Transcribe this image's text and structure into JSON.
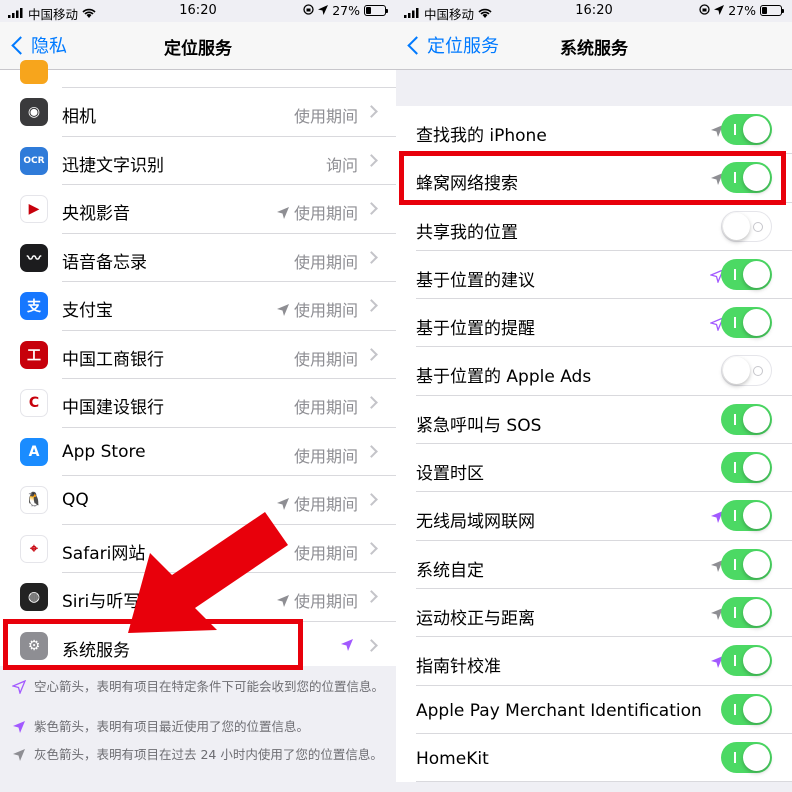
{
  "left": {
    "status_bar": {
      "carrier": "中国移动",
      "time": "16:20",
      "battery": "27%"
    },
    "nav": {
      "back_label": "隐私",
      "title": "定位服务"
    },
    "items": [
      {
        "label": "相机",
        "status": "使用期间",
        "arrow": "none",
        "icon": "camera-icon",
        "icon_bg": "#3a3a3c",
        "glyph": "◉"
      },
      {
        "label": "迅捷文字识别",
        "status": "询问",
        "arrow": "none",
        "icon": "ocr-icon",
        "icon_bg": "#2f7bd9",
        "glyph": "OCR"
      },
      {
        "label": "央视影音",
        "status": "使用期间",
        "arrow": "gray",
        "icon": "cctv-video-icon",
        "icon_bg": "#ffffff",
        "glyph": "▶"
      },
      {
        "label": "语音备忘录",
        "status": "使用期间",
        "arrow": "none",
        "icon": "voice-memo-icon",
        "icon_bg": "#1c1c1e",
        "glyph": "〰"
      },
      {
        "label": "支付宝",
        "status": "使用期间",
        "arrow": "gray",
        "icon": "alipay-icon",
        "icon_bg": "#1677ff",
        "glyph": "支"
      },
      {
        "label": "中国工商银行",
        "status": "使用期间",
        "arrow": "none",
        "icon": "icbc-icon",
        "icon_bg": "#c7000b",
        "glyph": "工"
      },
      {
        "label": "中国建设银行",
        "status": "使用期间",
        "arrow": "none",
        "icon": "ccb-icon",
        "icon_bg": "#ffffff",
        "glyph": "C"
      },
      {
        "label": "App Store",
        "status": "使用期间",
        "arrow": "none",
        "icon": "app-store-icon",
        "icon_bg": "#1a8cff",
        "glyph": "A"
      },
      {
        "label": "QQ",
        "status": "使用期间",
        "arrow": "gray",
        "icon": "qq-icon",
        "icon_bg": "#ffffff",
        "glyph": "🐧"
      },
      {
        "label": "Safari网站",
        "status": "使用期间",
        "arrow": "none",
        "icon": "safari-icon",
        "icon_bg": "#ffffff",
        "glyph": "⌖"
      },
      {
        "label": "Siri与听写",
        "status": "使用期间",
        "arrow": "gray",
        "icon": "siri-icon",
        "icon_bg": "#222",
        "glyph": "◍"
      },
      {
        "label": "系统服务",
        "status": "",
        "arrow": "purple",
        "icon": "settings-gear-icon",
        "icon_bg": "#8e8e93",
        "glyph": "⚙"
      }
    ],
    "footnotes": [
      {
        "text": "空心箭头，表明有项目在特定条件下可能会收到您的位置信息。",
        "arrow": "hollow"
      },
      {
        "text": "紫色箭头，表明有项目最近使用了您的位置信息。",
        "arrow": "purple"
      },
      {
        "text": "灰色箭头，表明有项目在过去 24 小时内使用了您的位置信息。",
        "arrow": "gray"
      }
    ]
  },
  "right": {
    "status_bar": {
      "carrier": "中国移动",
      "time": "16:20",
      "battery": "27%"
    },
    "nav": {
      "back_label": "定位服务",
      "title": "系统服务"
    },
    "items": [
      {
        "label": "查找我的 iPhone",
        "on": true,
        "arrow": "gray"
      },
      {
        "label": "蜂窝网络搜索",
        "on": true,
        "arrow": "gray"
      },
      {
        "label": "共享我的位置",
        "on": false,
        "arrow": "none"
      },
      {
        "label": "基于位置的建议",
        "on": true,
        "arrow": "hollow-purple"
      },
      {
        "label": "基于位置的提醒",
        "on": true,
        "arrow": "hollow-purple"
      },
      {
        "label": "基于位置的 Apple Ads",
        "on": false,
        "arrow": "none"
      },
      {
        "label": "紧急呼叫与 SOS",
        "on": true,
        "arrow": "none"
      },
      {
        "label": "设置时区",
        "on": true,
        "arrow": "none"
      },
      {
        "label": "无线局域网联网",
        "on": true,
        "arrow": "purple"
      },
      {
        "label": "系统自定",
        "on": true,
        "arrow": "gray"
      },
      {
        "label": "运动校正与距离",
        "on": true,
        "arrow": "gray"
      },
      {
        "label": "指南针校准",
        "on": true,
        "arrow": "purple"
      },
      {
        "label": "Apple Pay Merchant Identification",
        "on": true,
        "arrow": "none"
      },
      {
        "label": "HomeKit",
        "on": true,
        "arrow": "none"
      }
    ]
  },
  "colors": {
    "accent": "#007aff",
    "toggle_on": "#4cd964",
    "highlight": "#e8000b",
    "purple_arrow": "#a259ff",
    "gray_arrow": "#8e8e93"
  }
}
